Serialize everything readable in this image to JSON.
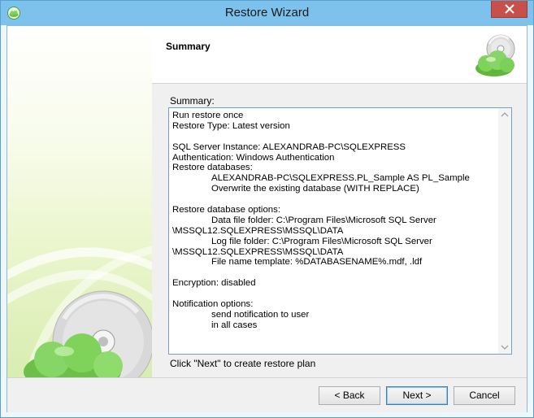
{
  "window": {
    "title": "Restore Wizard",
    "icons": {
      "app": "app-cloud-icon",
      "close": "close-icon"
    }
  },
  "header": {
    "title": "Summary",
    "logo_icon": "cd-cloud-logo-icon"
  },
  "summary": {
    "label": "Summary:",
    "lines": [
      "Run restore once",
      "Restore Type: Latest version",
      "",
      "SQL Server Instance: ALEXANDRAB-PC\\SQLEXPRESS",
      "Authentication: Windows Authentication",
      "Restore databases:",
      "ALEXANDRAB-PC\\SQLEXPRESS.PL_Sample AS PL_Sample",
      "Overwrite the existing database (WITH REPLACE)",
      "",
      "Restore database options:",
      "Data file folder: C:\\Program Files\\Microsoft SQL Server",
      "\\MSSQL12.SQLEXPRESS\\MSSQL\\DATA",
      "Log file folder: C:\\Program Files\\Microsoft SQL Server",
      "\\MSSQL12.SQLEXPRESS\\MSSQL\\DATA",
      "File name template: %DATABASENAME%.mdf, .ldf",
      "",
      "Encryption: disabled",
      "",
      "Notification options:",
      "send notification to user",
      "in all cases"
    ]
  },
  "hint": "Click \"Next\" to create restore plan",
  "buttons": {
    "back": "< Back",
    "next": "Next >",
    "cancel": "Cancel"
  },
  "colors": {
    "titlebar": "#7cc2ec",
    "close": "#c7504a",
    "accent_green": "#6cc04a"
  }
}
